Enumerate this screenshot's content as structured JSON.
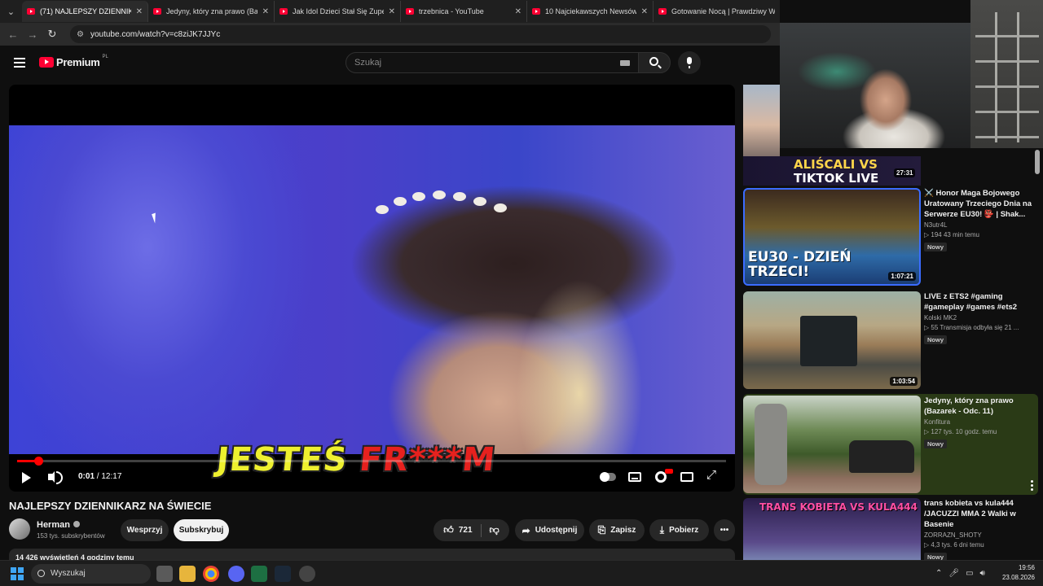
{
  "browser": {
    "tabs": [
      {
        "title": "(71) NAJLEPSZY DZIENNIKARZ",
        "active": true
      },
      {
        "title": "Jedyny, który zna prawo (Bazar"
      },
      {
        "title": "Jak Idol Dzieci Stał Się Zupełnie"
      },
      {
        "title": "trzebnica - YouTube"
      },
      {
        "title": "10 Najciekawszych Newsów Ty"
      },
      {
        "title": "Gotowanie Nocą | Prawdziwy W"
      }
    ],
    "url": "youtube.com/watch?v=c8ziJK7JJYc"
  },
  "header": {
    "logo": "Premium",
    "country": "PL",
    "search_placeholder": "Szukaj"
  },
  "player": {
    "caption_yellow": "JESTEŚ",
    "caption_red": "FR***M",
    "time_current": "0:01",
    "time_total": "12:17",
    "progress": 0.002
  },
  "video": {
    "title": "NAJLEPSZY DZIENNIKARZ NA ŚWIECIE",
    "channel": "Herman",
    "subscribers": "153 tys. subskrybentów",
    "support_label": "Wesprzyj",
    "subscribe_label": "Subskrybuj",
    "likes": "721",
    "share_label": "Udostępnij",
    "save_label": "Zapisz",
    "download_label": "Pobierz",
    "views_line": "14 426 wyświetleń  4 godziny temu"
  },
  "sidebar": {
    "first_thumb_line1": "ALIŚCALI VS",
    "first_thumb_line2": "TIKTOK LIVE",
    "first_duration": "27:31",
    "items": [
      {
        "title": "⚔️ Honor Maga Bojowego Uratowany Trzeciego Dnia na Serwerze EU30! 👺 | Shak...",
        "channel": "N3utr4L",
        "stats": "▷ 194   43 min temu",
        "badge": "Nowy",
        "duration": "1:07:21",
        "thumb_text": "EU30 - DZIEŃ TRZECI!"
      },
      {
        "title": "LIVE z ETS2 #gaming #gameplay #games #ets2",
        "channel": "Kolski MK2",
        "stats": "▷ 55   Transmisja odbyła się 21 ...",
        "badge": "Nowy",
        "duration": "1:03:54"
      },
      {
        "title": "Jedyny, który zna prawo (Bazarek - Odc. 11)",
        "channel": "Konfitura",
        "stats": "▷ 127 tys.   10 godz. temu",
        "badge": "Nowy"
      },
      {
        "title": "trans kobieta vs kula444 /JACUZZI MMA 2 Walki w Basenie",
        "channel": "ZORRAZN_SHOTY",
        "stats": "▷ 4,3 tys.   6 dni temu",
        "badge": "Nowy",
        "thumb_text": "TRANS KOBIETA VS KULA444"
      }
    ]
  },
  "taskbar": {
    "search_label": "Wyszukaj",
    "time": "19:56",
    "date": "23.08.2026"
  },
  "colors": {
    "background": "#0f0f0f",
    "accent_red": "#ff0033",
    "selected_rec": "#2a3a16"
  }
}
